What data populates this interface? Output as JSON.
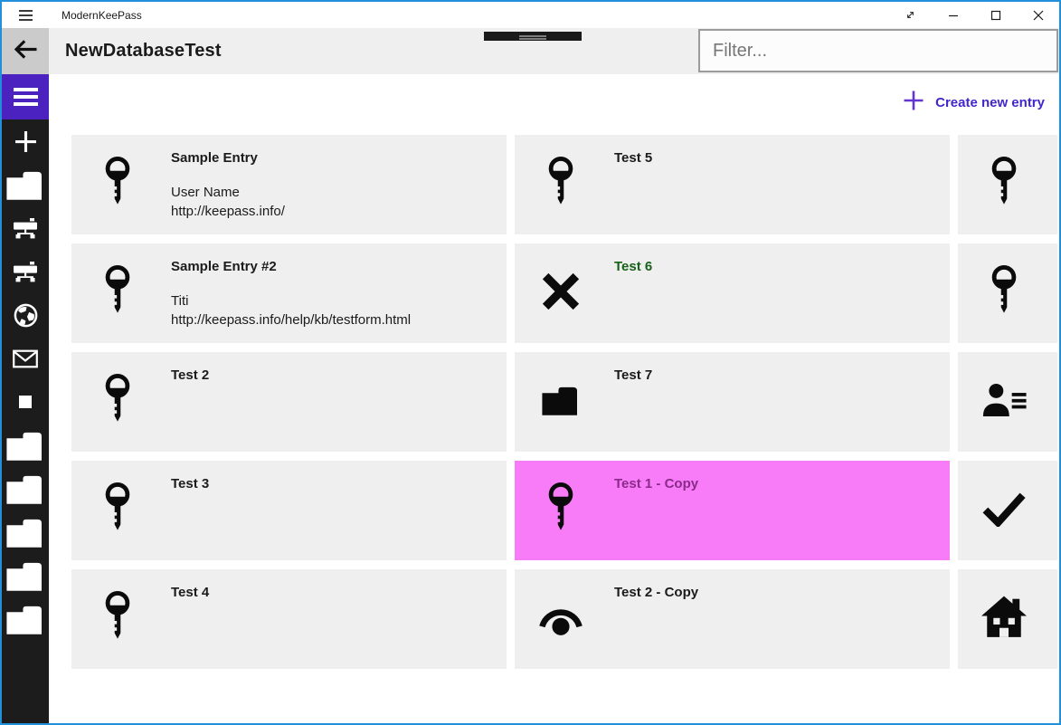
{
  "titlebar": {
    "app_title": "ModernKeePass",
    "controls": [
      {
        "name": "fullscreen-button",
        "icon": "diag-arrow-icon"
      },
      {
        "name": "minimize-button",
        "icon": "minimize-icon"
      },
      {
        "name": "maximize-button",
        "icon": "maximize-icon"
      },
      {
        "name": "close-button",
        "icon": "close-icon"
      }
    ]
  },
  "header": {
    "page_title": "NewDatabaseTest",
    "filter": {
      "placeholder": "Filter...",
      "value": ""
    }
  },
  "sidebar": {
    "menu_icon": "hamburger-icon",
    "items": [
      {
        "icon": "plus-icon"
      },
      {
        "icon": "folder-icon"
      },
      {
        "icon": "drive-network-icon"
      },
      {
        "icon": "drive-network-icon"
      },
      {
        "icon": "globe-icon"
      },
      {
        "icon": "mail-icon"
      },
      {
        "icon": "square-icon"
      },
      {
        "icon": "folder-icon"
      },
      {
        "icon": "folder-icon"
      },
      {
        "icon": "folder-icon"
      },
      {
        "icon": "folder-icon"
      },
      {
        "icon": "folder-icon"
      }
    ]
  },
  "toolbar": {
    "create_label": "Create new entry"
  },
  "entries": [
    {
      "title": "Sample Entry",
      "icon": "key-icon",
      "lines": [
        "User Name",
        "http://keepass.info/"
      ]
    },
    {
      "title": "Test 5",
      "icon": "key-icon",
      "lines": []
    },
    {
      "title": "",
      "icon": "key-icon",
      "lines": [],
      "clipped": true
    },
    {
      "title": "Sample Entry #2",
      "icon": "key-icon",
      "lines": [
        "Titi",
        "http://keepass.info/help/kb/testform.html"
      ]
    },
    {
      "title": "Test 6",
      "icon": "cross-icon",
      "lines": [],
      "title_color": "#186119"
    },
    {
      "title": "",
      "icon": "key-icon",
      "lines": [],
      "clipped": true
    },
    {
      "title": "Test 2",
      "icon": "key-icon",
      "lines": []
    },
    {
      "title": "Test 7",
      "icon": "folder-icon",
      "lines": []
    },
    {
      "title": "",
      "icon": "contact-icon",
      "lines": [],
      "clipped": true
    },
    {
      "title": "Test 3",
      "icon": "key-icon",
      "lines": []
    },
    {
      "title": "Test 1 - Copy",
      "icon": "key-icon",
      "lines": [],
      "selected": true
    },
    {
      "title": "",
      "icon": "check-icon",
      "lines": [],
      "clipped": true
    },
    {
      "title": "Test 4",
      "icon": "key-icon",
      "lines": []
    },
    {
      "title": "Test 2 - Copy",
      "icon": "eye-icon",
      "lines": []
    },
    {
      "title": "",
      "icon": "home-icon",
      "lines": [],
      "clipped": true
    }
  ],
  "colors": {
    "window_border": "#2190da",
    "accent_purple": "#4b21bf",
    "create_plus_purple": "#6434d2",
    "create_label_purple": "#4326cb",
    "card_bg": "#efefef",
    "selected_card_bg": "#f87bf8",
    "selected_title": "#8a2b8a",
    "green_title": "#186119",
    "sidebar_bg": "#1c1c1c",
    "header_bg": "#f0efef",
    "back_button_bg": "#cbcbcb"
  }
}
